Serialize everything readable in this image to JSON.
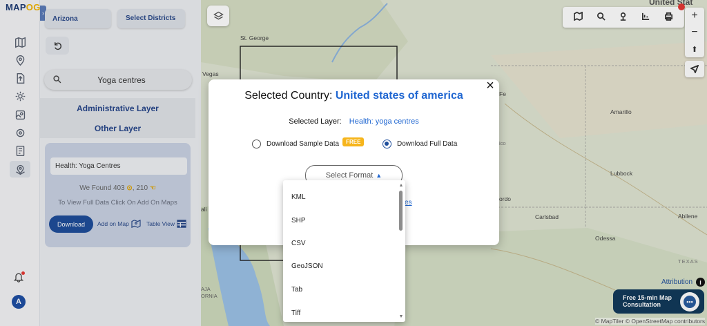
{
  "logo": {
    "part1": "MAP",
    "part2": "OG"
  },
  "collapse_glyph": "›",
  "panel": {
    "state_button": "Arizona",
    "districts_button": "Select Districts",
    "search_value": "Yoga centres",
    "admin_layer": "Administrative Layer",
    "other_layer": "Other Layer"
  },
  "result": {
    "title": "Health: Yoga Centres",
    "found_label": "We Found",
    "found_count": "403",
    "found_count_symbol": "⊙",
    "found_count_secondary": "210",
    "found_count_secondary_symbol": "☜",
    "hint": "To View Full Data Click On Add On Maps",
    "download": "Download",
    "add_on_map": "Add on Map",
    "table_view": "Table View"
  },
  "user": {
    "avatar_initial": "A"
  },
  "map": {
    "labels": {
      "st_george": "St. George",
      "vegas": "Vegas",
      "fe": "Fe",
      "amarillo": "Amarillo",
      "lubbock": "Lubbock",
      "carlsbad": "Carlsbad",
      "abilene": "Abilene",
      "odessa": "Odessa",
      "texas": "TEXAS",
      "ico": "ico",
      "ordo": "ordo",
      "ali": "ali",
      "aja_ornia": "AJA ORNIA",
      "united_states": "United Stat"
    },
    "attribution": "Attribution",
    "info_glyph": "i",
    "copyright": "© MapTiler © OpenStreetMap contributors",
    "consult": "Free 15-min Map Consultation",
    "chat_glyph": "•••",
    "zoom_in": "+",
    "zoom_out": "−",
    "compass": "⬆"
  },
  "modal": {
    "close": "×",
    "country_label": "Selected Country:",
    "country_value": "United states of america",
    "layer_label": "Selected Layer:",
    "layer_value": "Health: yoga centres",
    "sample_option": "Download Sample Data",
    "free_badge": "FREE",
    "full_option": "Download Full Data",
    "selected_option": "full",
    "format_placeholder": "Select Format",
    "format_caret": "▲",
    "partial_link": "es"
  },
  "format_menu": {
    "options": [
      "KML",
      "SHP",
      "CSV",
      "GeoJSON",
      "Tab",
      "Tiff"
    ],
    "scroll_up": "▲",
    "scroll_down": "▼"
  },
  "colors": {
    "brand": "#1f4e9b",
    "accent": "#f6b51c",
    "link": "#1f66d1",
    "alert": "#e53935"
  }
}
